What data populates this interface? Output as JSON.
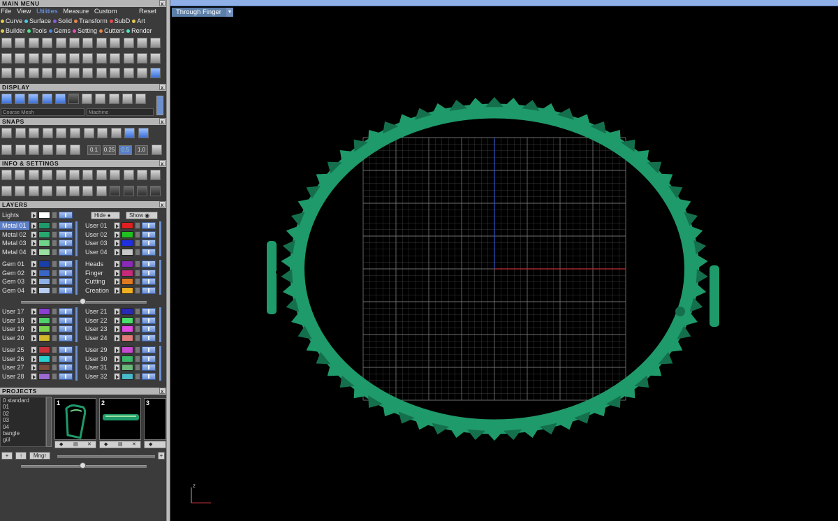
{
  "main_menu": {
    "title": "MAIN MENU",
    "close": "x",
    "menubar": [
      "File",
      "View",
      "Utilities",
      "Measure",
      "Custom"
    ],
    "reset": "Reset",
    "categories_row1": [
      {
        "label": "Curve",
        "color": "#e6c84a"
      },
      {
        "label": "Surface",
        "color": "#4ac8e6"
      },
      {
        "label": "Solid",
        "color": "#8a5ae6"
      },
      {
        "label": "Transform",
        "color": "#e6854a"
      },
      {
        "label": "SubD",
        "color": "#e64a4a"
      },
      {
        "label": "Art",
        "color": "#e6c84a"
      }
    ],
    "categories_row2": [
      {
        "label": "Builder",
        "color": "#e6c84a"
      },
      {
        "label": "Tools",
        "color": "#4ae68a"
      },
      {
        "label": "Gems",
        "color": "#4a8ae6"
      },
      {
        "label": "Setting",
        "color": "#e64ab8"
      },
      {
        "label": "Cutters",
        "color": "#e6854a"
      },
      {
        "label": "Render",
        "color": "#4ae6c8"
      }
    ]
  },
  "display": {
    "title": "DISPLAY",
    "close": "x",
    "mesh_mode": "Coarse Mesh",
    "material": "Machine"
  },
  "snaps": {
    "title": "SNAPS",
    "close": "x",
    "increments": [
      "0.1",
      "0.25",
      "0.5",
      "1.0"
    ],
    "active_increment": "0.5"
  },
  "info_settings": {
    "title": "INFO & SETTINGS",
    "close": "x"
  },
  "layers": {
    "title": "LAYERS",
    "close": "x",
    "lights_label": "Lights",
    "hide_label": "Hide",
    "show_label": "Show",
    "left_groups": [
      [
        {
          "name": "Metal 01",
          "color": "#1f9a6a",
          "selected": true
        },
        {
          "name": "Metal 02",
          "color": "#28a86e"
        },
        {
          "name": "Metal 03",
          "color": "#6fd48a"
        },
        {
          "name": "Metal 04",
          "color": "#9ae0a0"
        }
      ],
      [
        {
          "name": "Gem 01",
          "color": "#1a3fa8"
        },
        {
          "name": "Gem 02",
          "color": "#3a66c8"
        },
        {
          "name": "Gem 03",
          "color": "#8db0e8"
        },
        {
          "name": "Gem 04",
          "color": "#b8cdf0"
        }
      ],
      [
        {
          "name": "User 17",
          "color": "#8a3fd0"
        },
        {
          "name": "User 18",
          "color": "#4fd06a"
        },
        {
          "name": "User 19",
          "color": "#7ad04f"
        },
        {
          "name": "User 20",
          "color": "#d0b82a"
        }
      ],
      [
        {
          "name": "User 25",
          "color": "#c8303a"
        },
        {
          "name": "User 26",
          "color": "#2ad0d0"
        },
        {
          "name": "User 27",
          "color": "#7a4a3a"
        },
        {
          "name": "User 28",
          "color": "#9a6ad0"
        }
      ]
    ],
    "right_groups": [
      [
        {
          "name": "User 01",
          "color": "#e02020"
        },
        {
          "name": "User 02",
          "color": "#20c020"
        },
        {
          "name": "User 03",
          "color": "#2030e0"
        },
        {
          "name": "User 04",
          "color": "#c8c8c8"
        }
      ],
      [
        {
          "name": "Heads",
          "color": "#8a2ab8"
        },
        {
          "name": "Finger",
          "color": "#c82a7a"
        },
        {
          "name": "Cutting",
          "color": "#e07a20"
        },
        {
          "name": "Creation",
          "color": "#f0b020"
        }
      ],
      [
        {
          "name": "User 21",
          "color": "#2a2ab8"
        },
        {
          "name": "User 22",
          "color": "#4ae06a"
        },
        {
          "name": "User 23",
          "color": "#e04ae0"
        },
        {
          "name": "User 24",
          "color": "#e07a7a"
        }
      ],
      [
        {
          "name": "User 29",
          "color": "#c84ad0"
        },
        {
          "name": "User 30",
          "color": "#3ab86a"
        },
        {
          "name": "User 31",
          "color": "#6ab87a"
        },
        {
          "name": "User 32",
          "color": "#4ab8c8"
        }
      ]
    ]
  },
  "projects": {
    "title": "PROJECTS",
    "close": "x",
    "list": [
      "0 standard",
      "01",
      "02",
      "03",
      "04",
      "bangle",
      "gül"
    ],
    "thumbnails": [
      "1",
      "2",
      "3"
    ],
    "manager_label": "Mngr"
  },
  "viewport": {
    "view_label": "Through Finger",
    "axis_z": "z",
    "model_color": "#1f9a6a",
    "model_edge_color": "#14704c",
    "grid_color": "#7a7a7a",
    "axis_x_color": "#c0303a",
    "axis_y_color": "#3050c0"
  }
}
